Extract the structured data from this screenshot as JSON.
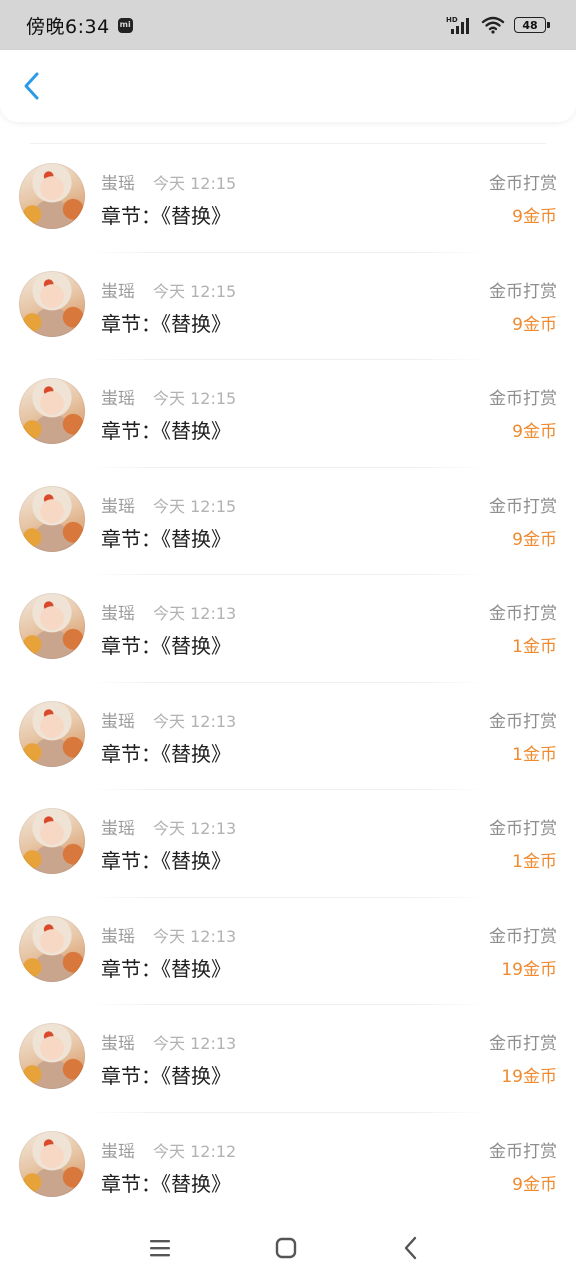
{
  "status_bar": {
    "time": "傍晚6:34",
    "mi_badge": "mi",
    "network_label": "HD",
    "battery": "48"
  },
  "header": {
    "back_icon": "chevron-left-icon",
    "accent_color": "#2b9be8"
  },
  "colors": {
    "reward_amount": "#ef8a2e",
    "muted_text": "#9a9a9a"
  },
  "records": [
    {
      "user": "蚩瑶",
      "time": "今天 12:15",
      "chapter": "章节：《替换》",
      "type": "金币打赏",
      "amount": "9金币"
    },
    {
      "user": "蚩瑶",
      "time": "今天 12:15",
      "chapter": "章节：《替换》",
      "type": "金币打赏",
      "amount": "9金币"
    },
    {
      "user": "蚩瑶",
      "time": "今天 12:15",
      "chapter": "章节：《替换》",
      "type": "金币打赏",
      "amount": "9金币"
    },
    {
      "user": "蚩瑶",
      "time": "今天 12:15",
      "chapter": "章节：《替换》",
      "type": "金币打赏",
      "amount": "9金币"
    },
    {
      "user": "蚩瑶",
      "time": "今天 12:13",
      "chapter": "章节：《替换》",
      "type": "金币打赏",
      "amount": "1金币"
    },
    {
      "user": "蚩瑶",
      "time": "今天 12:13",
      "chapter": "章节：《替换》",
      "type": "金币打赏",
      "amount": "1金币"
    },
    {
      "user": "蚩瑶",
      "time": "今天 12:13",
      "chapter": "章节：《替换》",
      "type": "金币打赏",
      "amount": "1金币"
    },
    {
      "user": "蚩瑶",
      "time": "今天 12:13",
      "chapter": "章节：《替换》",
      "type": "金币打赏",
      "amount": "19金币"
    },
    {
      "user": "蚩瑶",
      "time": "今天 12:13",
      "chapter": "章节：《替换》",
      "type": "金币打赏",
      "amount": "19金币"
    },
    {
      "user": "蚩瑶",
      "time": "今天 12:12",
      "chapter": "章节：《替换》",
      "type": "金币打赏",
      "amount": "9金币"
    }
  ],
  "nav": {
    "menu_icon": "menu-icon",
    "home_icon": "home-square-icon",
    "back_icon": "back-chevron-icon"
  }
}
